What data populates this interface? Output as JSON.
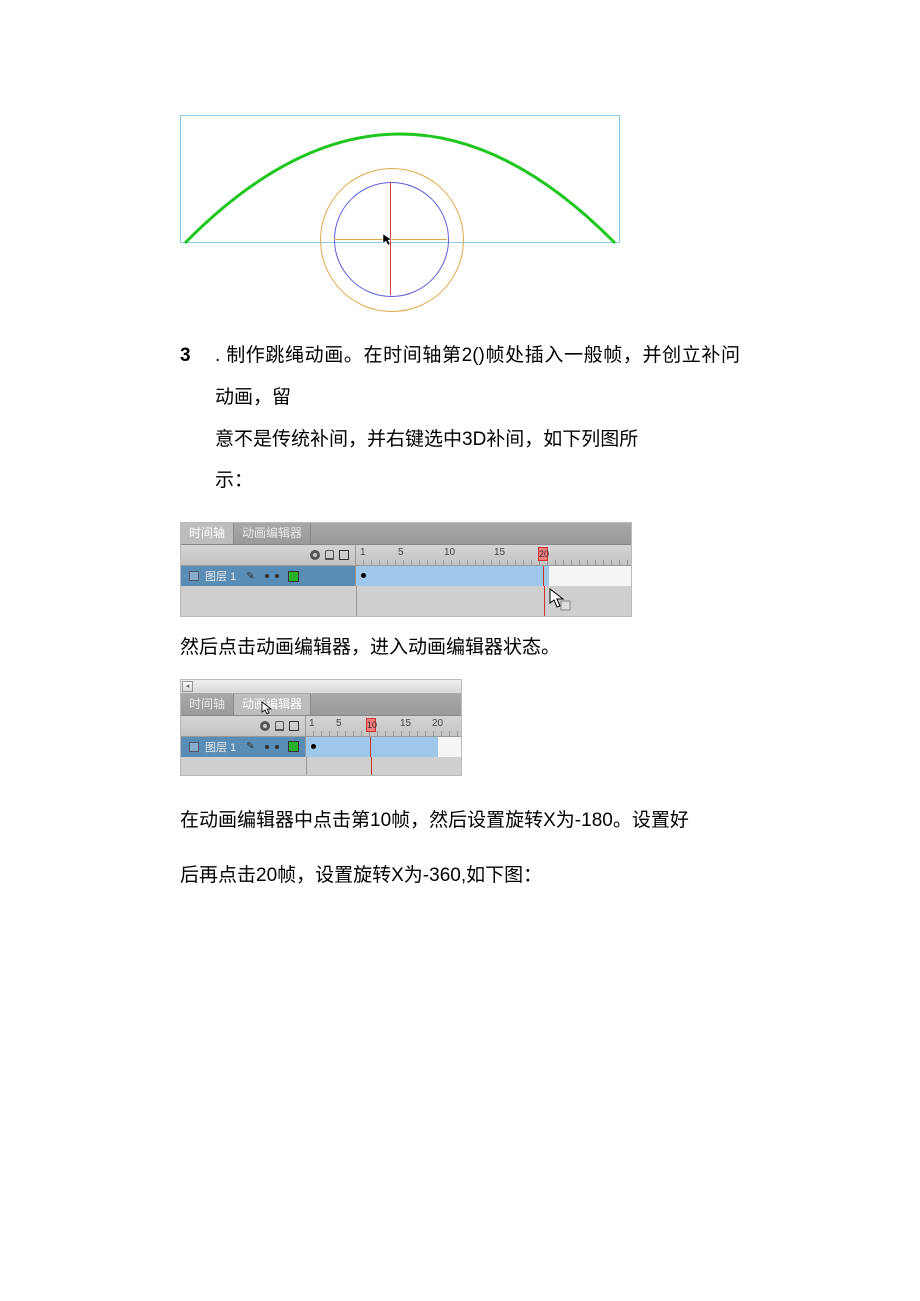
{
  "figure_arc": {
    "icon": "arc-with-circles"
  },
  "step": {
    "number": "3",
    "dot": ".",
    "text_line1": "制作跳绳动画。在时间轴第2()帧处插入一般帧，并创立补问动画，留",
    "text_line2": "意不是传统补间，并右键选中3D补间，如下列图所",
    "text_line3": "示："
  },
  "timeline1": {
    "tabs": {
      "timeline": "时间轴",
      "anim_editor": "动画编辑器"
    },
    "ruler": {
      "n1": "1",
      "n5": "5",
      "n10": "10",
      "n15": "15",
      "n20": "20"
    },
    "marker_value": "20",
    "layer": {
      "name": "图层 1"
    }
  },
  "para_after_tl1": "然后点击动画编辑器，进入动画编辑器状态。",
  "timeline2": {
    "tabs": {
      "timeline": "时间轴",
      "anim_editor": "动画编辑器"
    },
    "ruler": {
      "n1": "1",
      "n5": "5",
      "n10": "10",
      "n15": "15",
      "n20": "20"
    },
    "marker_value": "10",
    "layer": {
      "name": "图层 1"
    }
  },
  "para_final_l1": "在动画编辑器中点击第10帧，然后设置旋转X为-180。设置好",
  "para_final_l2": "后再点击20帧，设置旋转X为-360,如下图："
}
